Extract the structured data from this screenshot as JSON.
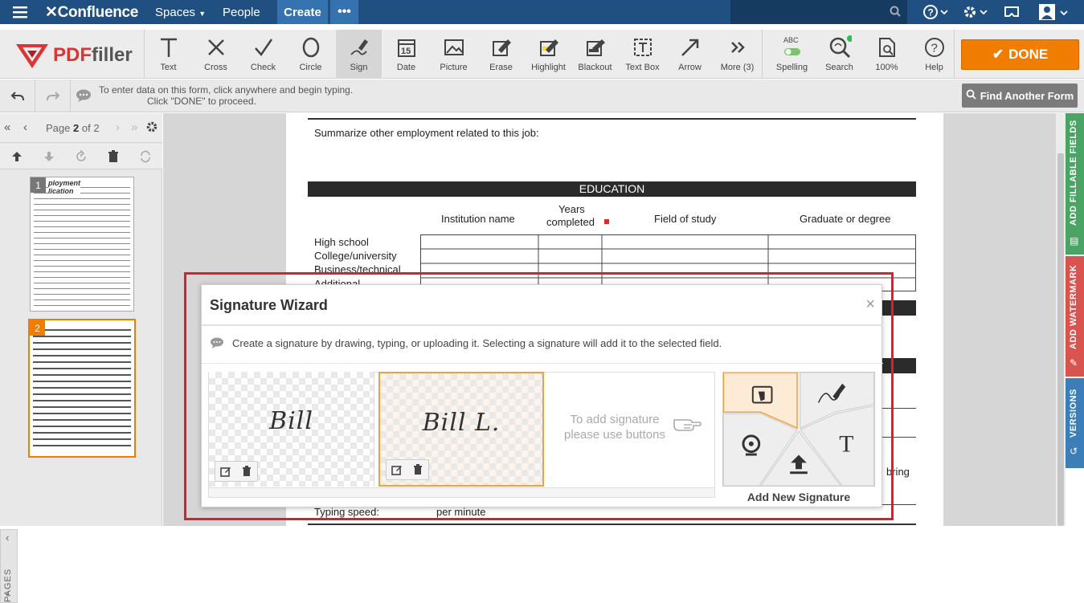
{
  "topnav": {
    "logo": "Confluence",
    "spaces": "Spaces",
    "people": "People",
    "create": "Create",
    "more": "•••"
  },
  "toolbar": {
    "logo_pdf": "PDF",
    "logo_filler": "filler",
    "tools": [
      {
        "label": "Text",
        "icon": "text-tool-icon"
      },
      {
        "label": "Cross",
        "icon": "cross-tool-icon"
      },
      {
        "label": "Check",
        "icon": "check-tool-icon"
      },
      {
        "label": "Circle",
        "icon": "circle-tool-icon"
      },
      {
        "label": "Sign",
        "icon": "sign-tool-icon"
      },
      {
        "label": "Date",
        "icon": "date-tool-icon"
      },
      {
        "label": "Picture",
        "icon": "picture-tool-icon"
      },
      {
        "label": "Erase",
        "icon": "erase-tool-icon"
      },
      {
        "label": "Highlight",
        "icon": "highlight-tool-icon"
      },
      {
        "label": "Blackout",
        "icon": "blackout-tool-icon"
      },
      {
        "label": "Text Box",
        "icon": "textbox-tool-icon"
      },
      {
        "label": "Arrow",
        "icon": "arrow-tool-icon"
      },
      {
        "label": "More (3)",
        "icon": "more-tool-icon"
      },
      {
        "label": "Spelling",
        "icon": "spelling-icon"
      },
      {
        "label": "Search",
        "icon": "search-icon"
      },
      {
        "label": "100%",
        "icon": "zoom-icon"
      },
      {
        "label": "Help",
        "icon": "help-icon"
      }
    ],
    "date_number": "15",
    "spelling_abc": "ABC",
    "done": "DONE"
  },
  "infobar": {
    "line1": "To enter data on this form, click anywhere and begin typing.",
    "line2": "Click \"DONE\" to proceed.",
    "find_form": "Find Another Form"
  },
  "pagenav": {
    "page_prefix": "Page",
    "current": "2",
    "of_total": "of 2"
  },
  "thumbnails": [
    {
      "num": "1",
      "title1": "ployment",
      "title2": "lication"
    },
    {
      "num": "2"
    }
  ],
  "pages_tab": "PAGES",
  "right_tabs": {
    "fillable": "ADD FILLABLE FIELDS",
    "watermark": "ADD WATERMARK",
    "versions": "VERSIONS"
  },
  "document": {
    "summarize": "Summarize other employment related to this job:",
    "education": "EDUCATION",
    "col_institution": "Institution name",
    "col_years1": "Years",
    "col_years2": "completed",
    "col_field": "Field of study",
    "col_graduate": "Graduate or degree",
    "rows": [
      "High school",
      "College/university",
      "Business/technical",
      "Additional"
    ],
    "bring": "bring",
    "typing": "Typing speed:",
    "per_minute": "per  minute"
  },
  "modal": {
    "title": "Signature Wizard",
    "close": "×",
    "description": "Create a signature by drawing, typing, or uploading it. Selecting a signature will add it to the selected field.",
    "signatures": [
      "Bill",
      "Bill L."
    ],
    "hint": "To add signature please use buttons",
    "type_glyph": "T",
    "add_new": "Add New Signature"
  }
}
